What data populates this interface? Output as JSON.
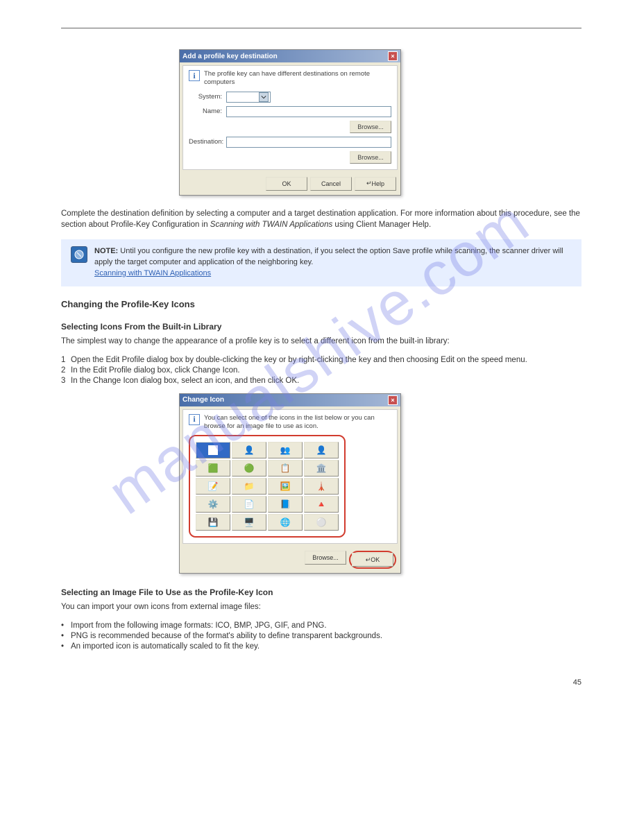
{
  "watermark": "manualshive.com",
  "dialog1": {
    "title": "Add a profile key destination",
    "infoText": "The profile key can have different destinations on remote computers",
    "systemLabel": "System:",
    "nameLabel": "Name:",
    "browseLabel": "Browse...",
    "destLabel": "Destination:",
    "browseLabel2": "Browse...",
    "okLabel": "OK",
    "cancelLabel": "Cancel",
    "helpLabel": "Help"
  },
  "text": {
    "para1a": "Complete the destination definition by selecting a computer and a target destination application. For more information about this procedure, see the section about Profile-Key Configuration in",
    "para1b": " using Client Manager Help.",
    "para2": "Until you configure the new profile key with a destination, if you select the option Save profile while scanning, the scanner driver will apply the target computer and application of the neighboring key.",
    "linkText": "Scanning with TWAIN Applications",
    "h1": "Changing the Profile-Key Icons",
    "h2": "Selecting Icons From the Built-in Library",
    "para3": "The simplest way to change the appearance of a profile key is to select a different icon from the built-in library:",
    "step1num": "1",
    "step1": "Open the Edit Profile dialog box by double-clicking the key or by right-clicking the key and then choosing Edit on the speed menu.",
    "step2num": "2",
    "step2": "In the Edit Profile dialog box, click Change Icon.",
    "step3num": "3",
    "step3": "In the Change Icon dialog box, select an icon, and then click OK.",
    "h3": "Selecting an Image File to Use as the Profile-Key Icon",
    "para4": "You can import your own icons from external image files:",
    "b1": "Import from the following image formats: ICO, BMP, JPG, GIF, and PNG.",
    "b2": "PNG is recommended because of the format's ability to define transparent backgrounds.",
    "b3": "An imported icon is automatically scaled to fit the key.",
    "pagenum": "45"
  },
  "dialog2": {
    "title": "Change Icon",
    "infoText": "You can select one of the icons in the list below or you can browse for an image file to use as icon.",
    "browseLabel": "Browse...",
    "okLabel": "OK"
  },
  "noteTitle": "NOTE:  "
}
